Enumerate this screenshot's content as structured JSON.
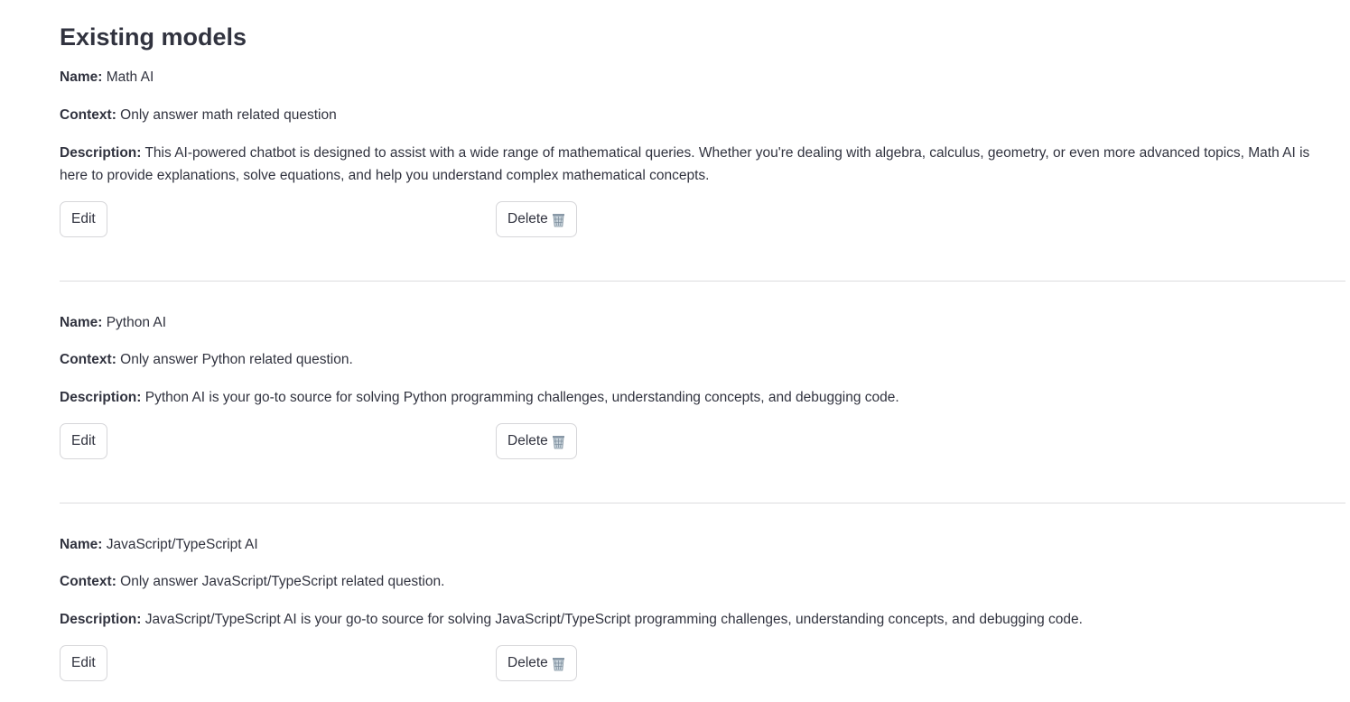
{
  "section_title": "Existing models",
  "labels": {
    "name": "Name:",
    "context": "Context:",
    "description": "Description:"
  },
  "buttons": {
    "edit": "Edit",
    "delete": "Delete"
  },
  "icons": {
    "delete_icon": "wastebasket-icon"
  },
  "models": [
    {
      "name": "Math AI",
      "context": "Only answer math related question",
      "description": "This AI-powered chatbot is designed to assist with a wide range of mathematical queries. Whether you're dealing with algebra, calculus, geometry, or even more advanced topics, Math AI is here to provide explanations, solve equations, and help you understand complex mathematical concepts."
    },
    {
      "name": "Python AI",
      "context": "Only answer Python related question.",
      "description": "Python AI is your go-to source for solving Python programming challenges, understanding concepts, and debugging code."
    },
    {
      "name": "JavaScript/TypeScript AI",
      "context": "Only answer JavaScript/TypeScript related question.",
      "description": "JavaScript/TypeScript AI is your go-to source for solving JavaScript/TypeScript programming challenges, understanding concepts, and debugging code."
    }
  ]
}
